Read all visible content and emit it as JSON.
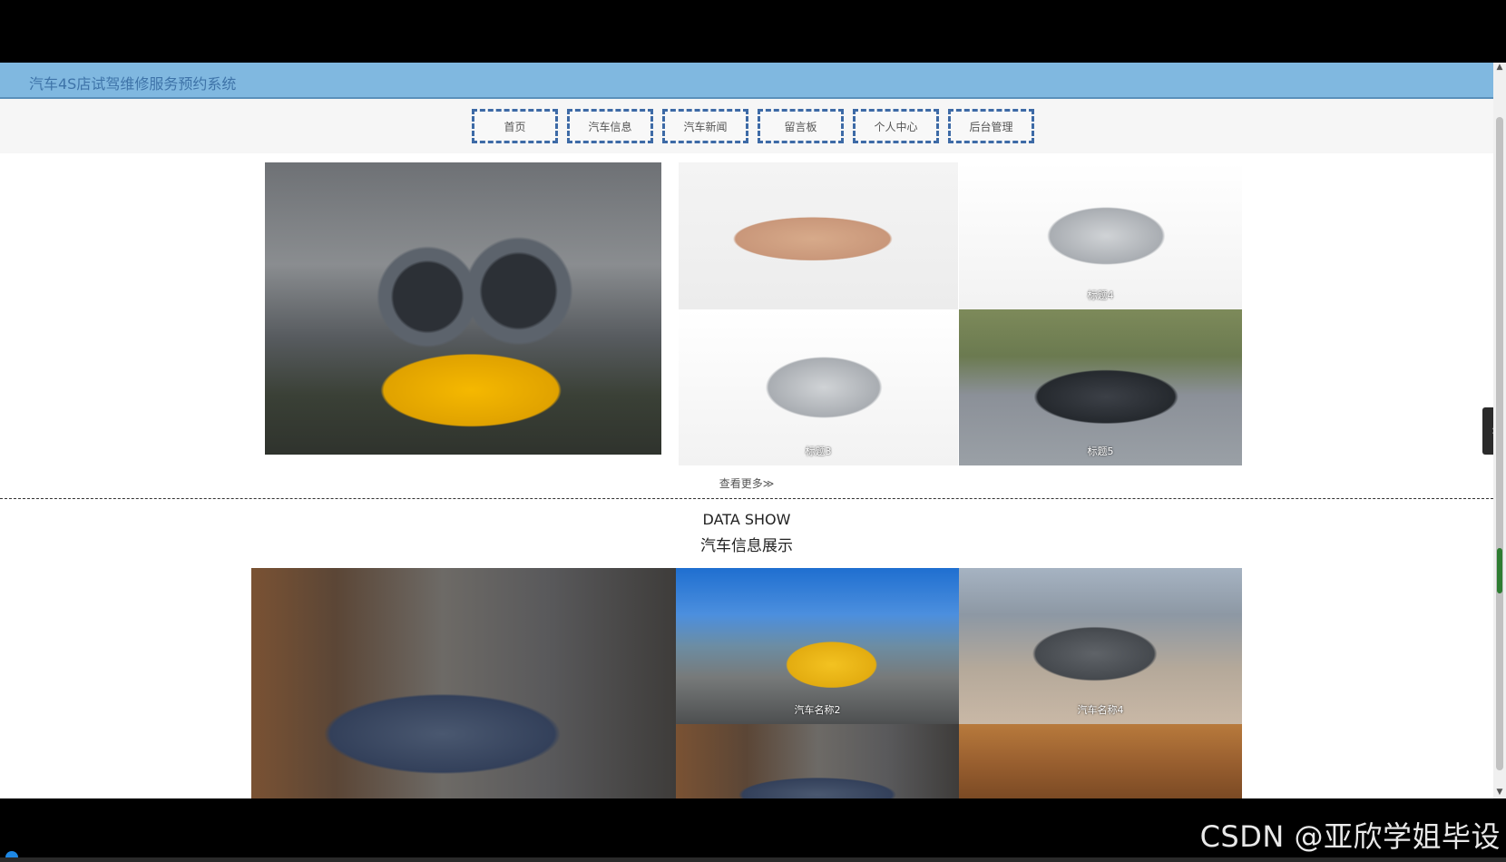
{
  "site": {
    "title": "汽车4S店试驾维修服务预约系统"
  },
  "nav": {
    "items": [
      {
        "label": "首页"
      },
      {
        "label": "汽车信息"
      },
      {
        "label": "汽车新闻"
      },
      {
        "label": "留言板"
      },
      {
        "label": "个人中心"
      },
      {
        "label": "后台管理"
      }
    ]
  },
  "carousel": {
    "captions": {
      "tile3": "标题3",
      "tile4": "标题4",
      "tile5": "标题5"
    },
    "more_label": "查看更多≫"
  },
  "section": {
    "title_en": "DATA SHOW",
    "title_cn": "汽车信息展示",
    "captions": {
      "car2": "汽车名称2",
      "car4": "汽车名称4"
    }
  },
  "watermark": "CSDN @亚欣学姐毕设",
  "icons": {
    "side_tab": "chevron-right-icon",
    "scroll_up": "triangle-up-icon",
    "scroll_down": "triangle-down-icon"
  }
}
